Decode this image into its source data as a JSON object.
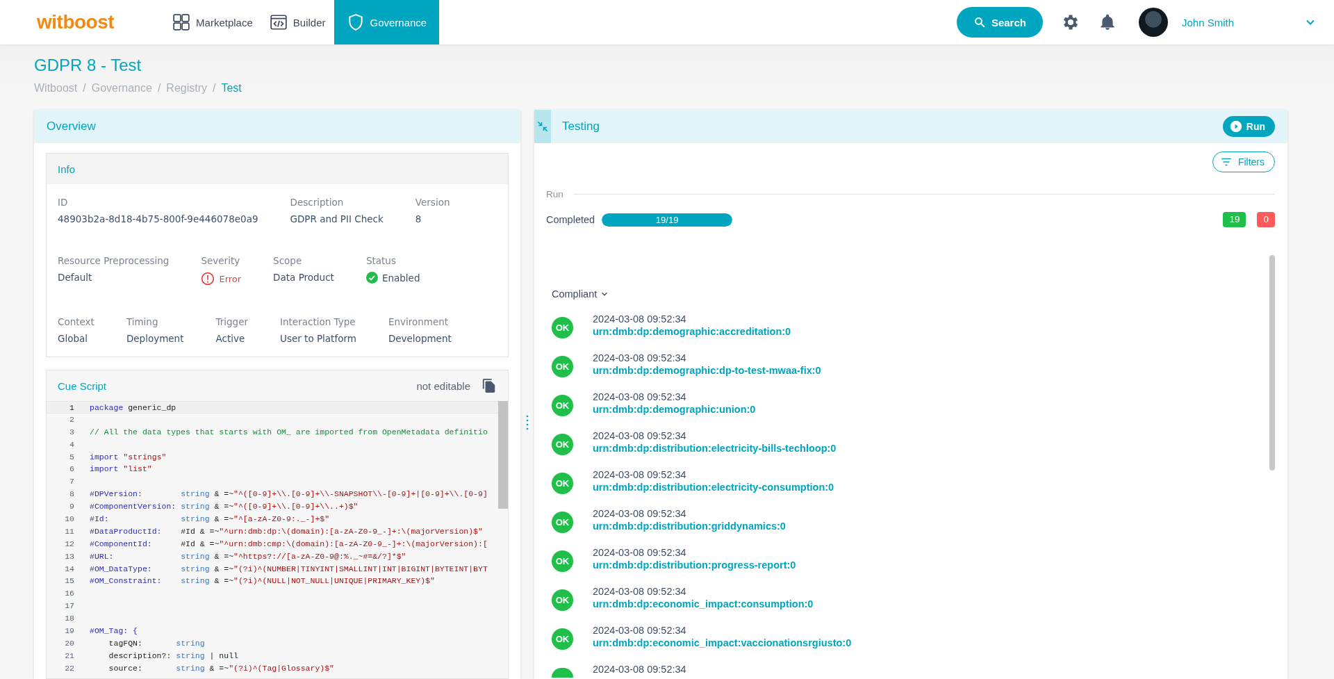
{
  "header": {
    "logo": "witboost",
    "nav": [
      {
        "label": "Marketplace",
        "selected": false
      },
      {
        "label": "Builder",
        "selected": false
      },
      {
        "label": "Governance",
        "selected": true
      }
    ],
    "search_button": "Search",
    "user": "John Smith"
  },
  "page": {
    "title": "GDPR 8 - Test",
    "breadcrumbs": [
      {
        "label": "Witboost",
        "current": false
      },
      {
        "separator": "/",
        "label": "Governance",
        "current": false
      },
      {
        "separator": "/",
        "label": "Registry",
        "current": false
      },
      {
        "separator": "/",
        "label": "Test",
        "current": true
      }
    ]
  },
  "overview": {
    "title": "Overview",
    "info": {
      "title": "Info",
      "rows": [
        {
          "fields": [
            {
              "label": "ID",
              "value": "48903b2a-8d18-4b75-800f-9e446078e0a9",
              "kind": "text"
            },
            {
              "label": "Description",
              "value": "GDPR and PII Check",
              "kind": "text"
            },
            {
              "label": "Version",
              "value": "8",
              "kind": "text"
            }
          ]
        },
        {
          "fields": [
            {
              "label": "Resource Preprocessing",
              "value": "Default",
              "kind": "text"
            },
            {
              "label": "Severity",
              "value": "Error",
              "kind": "severity"
            },
            {
              "label": "Scope",
              "value": "Data Product",
              "kind": "text"
            },
            {
              "label": "Status",
              "value": "Enabled",
              "kind": "status"
            }
          ]
        },
        {
          "fields": [
            {
              "label": "Context",
              "value": "Global",
              "kind": "text"
            },
            {
              "label": "Timing",
              "value": "Deployment",
              "kind": "text"
            },
            {
              "label": "Trigger",
              "value": "Active",
              "kind": "text"
            },
            {
              "label": "Interaction Type",
              "value": "User to Platform",
              "kind": "text"
            },
            {
              "label": "Environment",
              "value": "Development",
              "kind": "text"
            }
          ]
        }
      ]
    },
    "script": {
      "title": "Cue Script",
      "note": "not editable",
      "lines": [
        {
          "number": "1",
          "current": true,
          "tokens": [
            {
              "kind": "keyword",
              "text": "package"
            },
            {
              "kind": "plain",
              "text": " generic_dp"
            }
          ]
        },
        {
          "number": "2",
          "current": false
        },
        {
          "number": "3",
          "current": false,
          "tokens": [
            {
              "kind": "comment",
              "text": "// All the data types that starts with OM_ are imported from OpenMetadata definitio"
            }
          ]
        },
        {
          "number": "4",
          "current": false
        },
        {
          "number": "5",
          "current": false,
          "tokens": [
            {
              "kind": "keyword",
              "text": "import"
            },
            {
              "kind": "string",
              "text": " \"strings\""
            }
          ]
        },
        {
          "number": "6",
          "current": false,
          "tokens": [
            {
              "kind": "keyword",
              "text": "import"
            },
            {
              "kind": "string",
              "text": " \"list\""
            }
          ]
        },
        {
          "number": "7",
          "current": false
        },
        {
          "number": "8",
          "current": false,
          "tokens": [
            {
              "kind": "keyword",
              "text": "#DPVersion:"
            },
            {
              "kind": "type",
              "text": "        string"
            },
            {
              "kind": "plain",
              "text": " & =~"
            },
            {
              "kind": "string",
              "text": "\"^([0-9]+\\\\.[0-9]+\\\\-SNAPSHOT\\\\-[0-9]+|[0-9]+\\\\.[0-9]"
            }
          ]
        },
        {
          "number": "9",
          "current": false,
          "tokens": [
            {
              "kind": "keyword",
              "text": "#ComponentVersion:"
            },
            {
              "kind": "type",
              "text": " string"
            },
            {
              "kind": "plain",
              "text": " & =~"
            },
            {
              "kind": "string",
              "text": "\"^([0-9]+\\\\.[0-9]+\\\\..+)$\""
            }
          ]
        },
        {
          "number": "10",
          "current": false,
          "tokens": [
            {
              "kind": "keyword",
              "text": "#Id:"
            },
            {
              "kind": "type",
              "text": "               string"
            },
            {
              "kind": "plain",
              "text": " & =~"
            },
            {
              "kind": "string",
              "text": "\"^[a-zA-Z0-9:._-]+$\""
            }
          ]
        },
        {
          "number": "11",
          "current": false,
          "tokens": [
            {
              "kind": "keyword",
              "text": "#DataProductId:"
            },
            {
              "kind": "plain",
              "text": "    #Id & =~"
            },
            {
              "kind": "string",
              "text": "\"^urn:dmb:dp:\\(domain):[a-zA-Z0-9_-]+:\\(majorVersion)$\""
            }
          ]
        },
        {
          "number": "12",
          "current": false,
          "tokens": [
            {
              "kind": "keyword",
              "text": "#ComponentId:"
            },
            {
              "kind": "plain",
              "text": "      #Id & =~"
            },
            {
              "kind": "string",
              "text": "\"^urn:dmb:cmp:\\(domain):[a-zA-Z0-9_-]+:\\(majorVersion):["
            }
          ]
        },
        {
          "number": "13",
          "current": false,
          "tokens": [
            {
              "kind": "keyword",
              "text": "#URL:"
            },
            {
              "kind": "type",
              "text": "              string"
            },
            {
              "kind": "plain",
              "text": " & =~"
            },
            {
              "kind": "string",
              "text": "\"^https?://[a-zA-Z0-9@:%._~#=&/?]*$\""
            }
          ]
        },
        {
          "number": "14",
          "current": false,
          "tokens": [
            {
              "kind": "keyword",
              "text": "#OM_DataType:"
            },
            {
              "kind": "type",
              "text": "      string"
            },
            {
              "kind": "plain",
              "text": " & =~"
            },
            {
              "kind": "string",
              "text": "\"(?i)^(NUMBER|TINYINT|SMALLINT|INT|BIGINT|BYTEINT|BYT"
            }
          ]
        },
        {
          "number": "15",
          "current": false,
          "tokens": [
            {
              "kind": "keyword",
              "text": "#OM_Constraint:"
            },
            {
              "kind": "type",
              "text": "    string"
            },
            {
              "kind": "plain",
              "text": " & =~"
            },
            {
              "kind": "string",
              "text": "\"(?i)^(NULL|NOT_NULL|UNIQUE|PRIMARY_KEY)$\""
            }
          ]
        },
        {
          "number": "16",
          "current": false
        },
        {
          "number": "17",
          "current": false
        },
        {
          "number": "18",
          "current": false
        },
        {
          "number": "19",
          "current": false,
          "tokens": [
            {
              "kind": "keyword",
              "text": "#OM_Tag: {"
            }
          ]
        },
        {
          "number": "20",
          "current": false,
          "tokens": [
            {
              "kind": "plain",
              "text": "    tagFQN:       "
            },
            {
              "kind": "type",
              "text": "string"
            }
          ]
        },
        {
          "number": "21",
          "current": false,
          "tokens": [
            {
              "kind": "plain",
              "text": "    description?: "
            },
            {
              "kind": "type",
              "text": "string"
            },
            {
              "kind": "plain",
              "text": " | null"
            }
          ]
        },
        {
          "number": "22",
          "current": false,
          "tokens": [
            {
              "kind": "plain",
              "text": "    source:       "
            },
            {
              "kind": "type",
              "text": "string"
            },
            {
              "kind": "plain",
              "text": " & =~"
            },
            {
              "kind": "string",
              "text": "\"(?i)^(Tag|Glossary)$\""
            }
          ]
        }
      ]
    }
  },
  "testing": {
    "title": "Testing",
    "run_button": "Run",
    "filters_button": "Filters",
    "run_label": "Run",
    "progress": {
      "label": "Completed",
      "text": "19/19",
      "level": 1
    },
    "passed_count": "19",
    "failed_count": "0",
    "group": "Compliant",
    "results": [
      {
        "badge": "OK",
        "time": "2024-03-08 09:52:34",
        "urn": "urn:dmb:dp:demographic:accreditation:0"
      },
      {
        "badge": "OK",
        "time": "2024-03-08 09:52:34",
        "urn": "urn:dmb:dp:demographic:dp-to-test-mwaa-fix:0"
      },
      {
        "badge": "OK",
        "time": "2024-03-08 09:52:34",
        "urn": "urn:dmb:dp:demographic:union:0"
      },
      {
        "badge": "OK",
        "time": "2024-03-08 09:52:34",
        "urn": "urn:dmb:dp:distribution:electricity-bills-techloop:0"
      },
      {
        "badge": "OK",
        "time": "2024-03-08 09:52:34",
        "urn": "urn:dmb:dp:distribution:electricity-consumption:0"
      },
      {
        "badge": "OK",
        "time": "2024-03-08 09:52:34",
        "urn": "urn:dmb:dp:distribution:griddynamics:0"
      },
      {
        "badge": "OK",
        "time": "2024-03-08 09:52:34",
        "urn": "urn:dmb:dp:distribution:progress-report:0"
      },
      {
        "badge": "OK",
        "time": "2024-03-08 09:52:34",
        "urn": "urn:dmb:dp:economic_impact:consumption:0"
      },
      {
        "badge": "OK",
        "time": "2024-03-08 09:52:34",
        "urn": "urn:dmb:dp:economic_impact:vaccionationsrgiusto:0"
      },
      {
        "time": "2024-03-08 09:52:34"
      }
    ]
  }
}
